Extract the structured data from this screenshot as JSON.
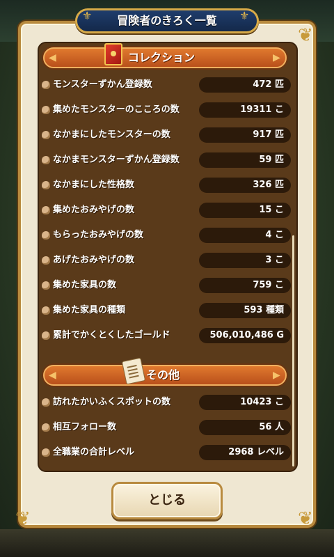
{
  "window": {
    "title": "冒険者のきろく一覧"
  },
  "sections": [
    {
      "title": "コレクション",
      "rows": [
        {
          "label": "モンスターずかん登録数",
          "value": "472 匹"
        },
        {
          "label": "集めたモンスターのこころの数",
          "value": "19311 こ"
        },
        {
          "label": "なかまにしたモンスターの数",
          "value": "917 匹"
        },
        {
          "label": "なかまモンスターずかん登録数",
          "value": "59 匹"
        },
        {
          "label": "なかまにした性格数",
          "value": "326 匹"
        },
        {
          "label": "集めたおみやげの数",
          "value": "15 こ"
        },
        {
          "label": "もらったおみやげの数",
          "value": "4 こ"
        },
        {
          "label": "あげたおみやげの数",
          "value": "3 こ"
        },
        {
          "label": "集めた家具の数",
          "value": "759 こ"
        },
        {
          "label": "集めた家具の種類",
          "value": "593 種類"
        },
        {
          "label": "累計でかくとくしたゴールド",
          "value": "506,010,486 G"
        }
      ]
    },
    {
      "title": "その他",
      "rows": [
        {
          "label": "訪れたかいふくスポットの数",
          "value": "10423 こ"
        },
        {
          "label": "相互フォロー数",
          "value": "56 人"
        },
        {
          "label": "全職業の合計レベル",
          "value": "2968 レベル"
        }
      ]
    }
  ],
  "buttons": {
    "close_label": "とじる"
  },
  "icons": {
    "collection": "red-book-icon",
    "other": "scroll-icon",
    "bullet": "pouch-bullet-icon"
  },
  "colors": {
    "panel": "#5a3a1a",
    "section_header": "#d0652a",
    "title_plaque": "#1f3d6c",
    "value_box": "#2c1a0a",
    "frame": "#efe7d2"
  }
}
